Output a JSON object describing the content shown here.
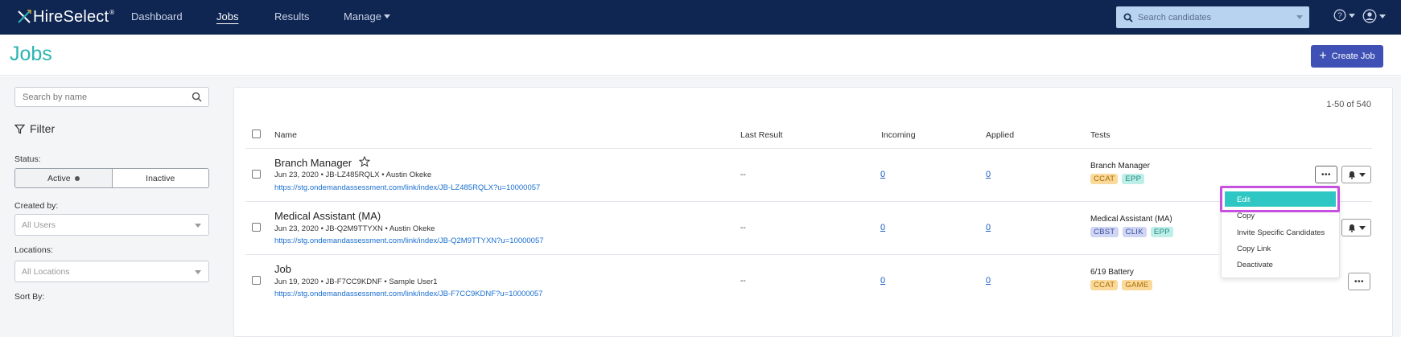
{
  "nav": {
    "brand": "HireSelect",
    "brand_mark": "®",
    "items": [
      {
        "label": "Dashboard",
        "active": false
      },
      {
        "label": "Jobs",
        "active": true
      },
      {
        "label": "Results",
        "active": false
      },
      {
        "label": "Manage",
        "active": false,
        "dropdown": true
      }
    ],
    "search_placeholder": "Search candidates",
    "icons": [
      "help-icon",
      "user-icon"
    ]
  },
  "page": {
    "title": "Jobs",
    "create_button": "Create Job"
  },
  "sidebar": {
    "search_placeholder": "Search by name",
    "filter_title": "Filter",
    "status_label": "Status:",
    "status_active": "Active",
    "status_inactive": "Inactive",
    "created_by_label": "Created by:",
    "created_by_value": "All Users",
    "locations_label": "Locations:",
    "locations_value": "All Locations",
    "sort_label": "Sort By:"
  },
  "table": {
    "count": "1-50 of 540",
    "headers": {
      "name": "Name",
      "last_result": "Last Result",
      "incoming": "Incoming",
      "applied": "Applied",
      "tests": "Tests"
    },
    "rows": [
      {
        "name": "Branch Manager",
        "meta": "Jun 23, 2020 • JB-LZ485RQLX • Austin Okeke",
        "link": "https://stg.ondemandassessment.com/link/index/JB-LZ485RQLX?u=10000057",
        "last_result": "--",
        "incoming": "0",
        "applied": "0",
        "test_name": "Branch Manager",
        "tags": [
          "CCAT",
          "EPP"
        ]
      },
      {
        "name": "Medical Assistant (MA)",
        "meta": "Jun 23, 2020 • JB-Q2M9TTYXN • Austin Okeke",
        "link": "https://stg.ondemandassessment.com/link/index/JB-Q2M9TTYXN?u=10000057",
        "last_result": "--",
        "incoming": "0",
        "applied": "0",
        "test_name": "Medical Assistant (MA)",
        "tags": [
          "CBST",
          "CLIK",
          "EPP"
        ]
      },
      {
        "name": "Job",
        "meta": "Jun 19, 2020 • JB-F7CC9KDNF • Sample User1",
        "link": "https://stg.ondemandassessment.com/link/index/JB-F7CC9KDNF?u=10000057",
        "last_result": "--",
        "incoming": "0",
        "applied": "0",
        "test_name": "6/19 Battery",
        "tags": [
          "CCAT",
          "GAME"
        ]
      }
    ],
    "ellipsis": "•••"
  },
  "menu": {
    "items": [
      "Edit",
      "Copy",
      "Invite Specific Candidates",
      "Copy Link",
      "Deactivate"
    ]
  },
  "colors": {
    "nav_bg": "#0f2552",
    "accent_teal": "#2bb5b1",
    "primary_button": "#3f51b5",
    "highlight": "#c750e0"
  }
}
